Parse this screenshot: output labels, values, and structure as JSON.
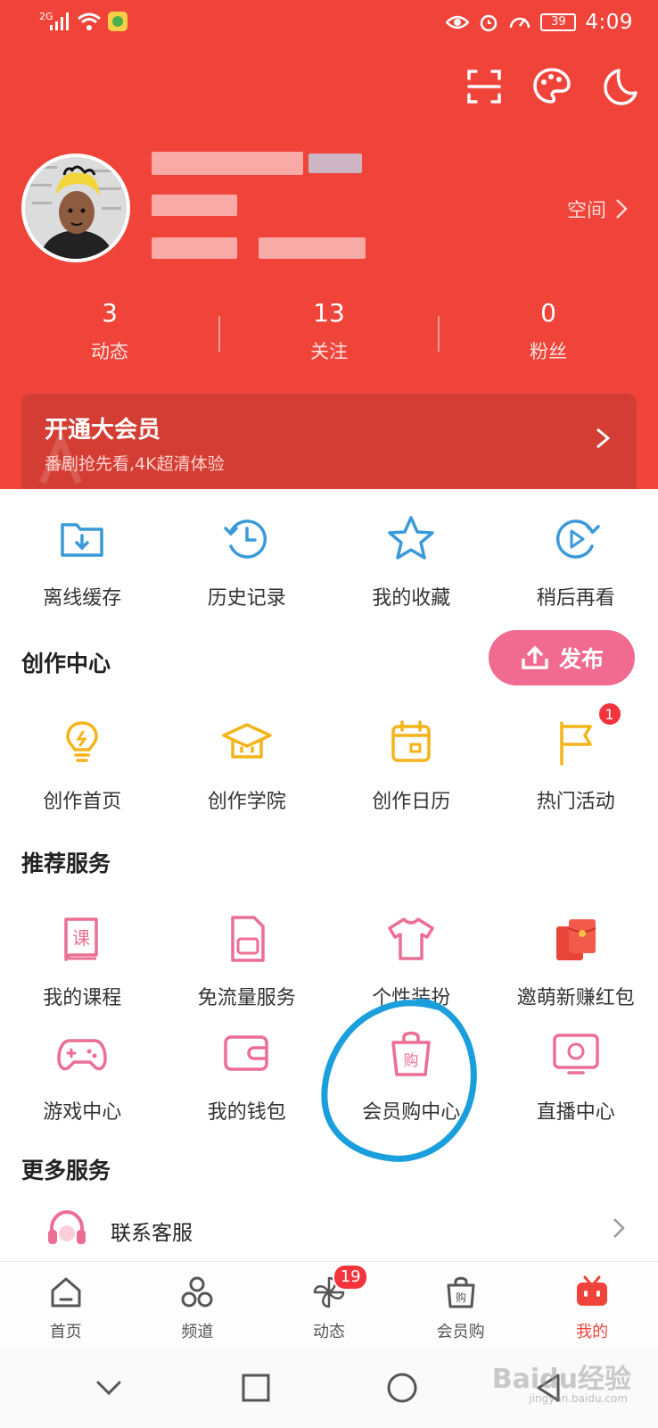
{
  "status_bar": {
    "network": "2G",
    "battery": "39",
    "time": "4:09"
  },
  "profile": {
    "space_link": "空间"
  },
  "stats": [
    {
      "value": "3",
      "label": "动态"
    },
    {
      "value": "13",
      "label": "关注"
    },
    {
      "value": "0",
      "label": "粉丝"
    }
  ],
  "vip": {
    "title": "开通大会员",
    "subtitle": "番剧抢先看,4K超清体验"
  },
  "quick_actions": [
    {
      "label": "离线缓存",
      "icon": "download-folder-icon"
    },
    {
      "label": "历史记录",
      "icon": "history-clock-icon"
    },
    {
      "label": "我的收藏",
      "icon": "star-icon"
    },
    {
      "label": "稍后再看",
      "icon": "play-later-icon"
    }
  ],
  "creation_center": {
    "title": "创作中心",
    "publish_label": "发布",
    "items": [
      {
        "label": "创作首页",
        "icon": "lightbulb-icon"
      },
      {
        "label": "创作学院",
        "icon": "graduation-cap-icon"
      },
      {
        "label": "创作日历",
        "icon": "calendar-icon"
      },
      {
        "label": "热门活动",
        "icon": "flag-icon",
        "badge": "1"
      }
    ]
  },
  "recommended": {
    "title": "推荐服务",
    "row1": [
      {
        "label": "我的课程",
        "icon": "course-book-icon"
      },
      {
        "label": "免流量服务",
        "icon": "sim-card-icon"
      },
      {
        "label": "个性装扮",
        "icon": "tshirt-icon"
      },
      {
        "label": "邀萌新赚红包",
        "icon": "red-envelope-icon"
      }
    ],
    "row2": [
      {
        "label": "游戏中心",
        "icon": "gamepad-icon"
      },
      {
        "label": "我的钱包",
        "icon": "wallet-icon"
      },
      {
        "label": "会员购中心",
        "icon": "shopping-bag-icon"
      },
      {
        "label": "直播中心",
        "icon": "live-tv-icon"
      }
    ]
  },
  "more_services": {
    "title": "更多服务",
    "items": [
      {
        "label": "联系客服",
        "icon": "headset-icon"
      }
    ]
  },
  "bottom_nav": [
    {
      "label": "首页",
      "icon": "home-icon"
    },
    {
      "label": "频道",
      "icon": "channel-icon"
    },
    {
      "label": "动态",
      "icon": "pinwheel-icon",
      "badge": "19"
    },
    {
      "label": "会员购",
      "icon": "shop-bag-icon"
    },
    {
      "label": "我的",
      "icon": "tv-mascot-icon",
      "active": true
    }
  ],
  "system_nav": [
    "chevron-down-icon",
    "square-icon",
    "circle-icon",
    "back-triangle-icon"
  ],
  "watermark": {
    "brand": "Baidu经验",
    "url": "jingyan.baidu.com"
  },
  "colors": {
    "header_red": "#f0443a",
    "vip_card": "#d33d33",
    "blue_icons": "#3a9ad9",
    "yellow_icons": "#f4b41a",
    "pink_icons": "#ec6f93",
    "publish_pink": "#f06b8f",
    "highlight_blue": "#1a9fdc"
  }
}
